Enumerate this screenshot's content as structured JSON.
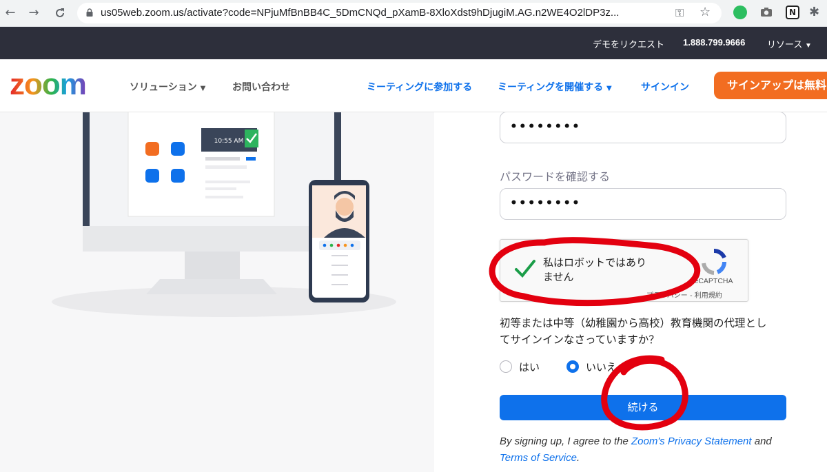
{
  "browser": {
    "url": "us05web.zoom.us/activate?code=NPjuMfBnBB4C_5DmCNQd_pXamB-8XloXdst9hDjugiM.AG.n2WE4O2lDP3z...",
    "icons": [
      "back-icon",
      "forward-icon",
      "reload-icon",
      "lock-icon",
      "key-icon",
      "star-icon",
      "evernote-icon",
      "camera-icon",
      "notion-icon",
      "extensions-icon"
    ]
  },
  "topbar": {
    "request_demo": "デモをリクエスト",
    "phone": "1.888.799.9666",
    "resources": "リソース"
  },
  "header": {
    "logo": "zoom",
    "solutions": "ソリューション",
    "contact": "お問い合わせ",
    "join_meeting": "ミーティングに参加する",
    "host_meeting": "ミーティングを開催する",
    "sign_in": "サインイン",
    "sign_up": "サインアップは無料"
  },
  "illustration": {
    "clock_time": "10:55 AM"
  },
  "form": {
    "password_value": "••••••••",
    "confirm_label": "パスワードを確認する",
    "confirm_value": "••••••••",
    "captcha": {
      "label_line1": "私はロボットではあり",
      "label_line2": "ません",
      "brand": "reCAPTCHA",
      "links": "プライバシー - 利用規約"
    },
    "question_line1": "初等または中等（幼稚園から高校）教育機関の代理とし",
    "question_line2": "てサインインなさっていますか？",
    "yes": "はい",
    "no": "いいえ",
    "continue": "続ける",
    "terms_prefix": "By signing up, I agree to the ",
    "privacy_link": "Zoom's Privacy Statement",
    "terms_and": " and",
    "terms_link": "Terms of Service",
    "terms_end": "."
  },
  "colors": {
    "brand_blue": "#0e71eb",
    "signup_orange": "#f26d21",
    "topbar_dark": "#2d2f3b",
    "annotation_red": "#e3000f",
    "check_green": "#1a9d48"
  }
}
